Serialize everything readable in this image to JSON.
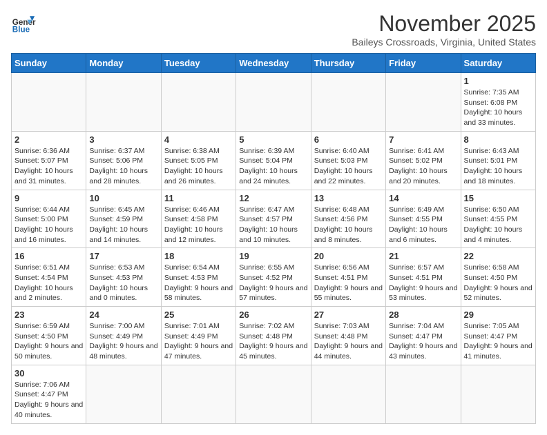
{
  "logo": {
    "text_general": "General",
    "text_blue": "Blue"
  },
  "title": "November 2025",
  "subtitle": "Baileys Crossroads, Virginia, United States",
  "days_of_week": [
    "Sunday",
    "Monday",
    "Tuesday",
    "Wednesday",
    "Thursday",
    "Friday",
    "Saturday"
  ],
  "weeks": [
    [
      {
        "day": "",
        "info": ""
      },
      {
        "day": "",
        "info": ""
      },
      {
        "day": "",
        "info": ""
      },
      {
        "day": "",
        "info": ""
      },
      {
        "day": "",
        "info": ""
      },
      {
        "day": "",
        "info": ""
      },
      {
        "day": "1",
        "info": "Sunrise: 7:35 AM\nSunset: 6:08 PM\nDaylight: 10 hours and 33 minutes."
      }
    ],
    [
      {
        "day": "2",
        "info": "Sunrise: 6:36 AM\nSunset: 5:07 PM\nDaylight: 10 hours and 31 minutes."
      },
      {
        "day": "3",
        "info": "Sunrise: 6:37 AM\nSunset: 5:06 PM\nDaylight: 10 hours and 28 minutes."
      },
      {
        "day": "4",
        "info": "Sunrise: 6:38 AM\nSunset: 5:05 PM\nDaylight: 10 hours and 26 minutes."
      },
      {
        "day": "5",
        "info": "Sunrise: 6:39 AM\nSunset: 5:04 PM\nDaylight: 10 hours and 24 minutes."
      },
      {
        "day": "6",
        "info": "Sunrise: 6:40 AM\nSunset: 5:03 PM\nDaylight: 10 hours and 22 minutes."
      },
      {
        "day": "7",
        "info": "Sunrise: 6:41 AM\nSunset: 5:02 PM\nDaylight: 10 hours and 20 minutes."
      },
      {
        "day": "8",
        "info": "Sunrise: 6:43 AM\nSunset: 5:01 PM\nDaylight: 10 hours and 18 minutes."
      }
    ],
    [
      {
        "day": "9",
        "info": "Sunrise: 6:44 AM\nSunset: 5:00 PM\nDaylight: 10 hours and 16 minutes."
      },
      {
        "day": "10",
        "info": "Sunrise: 6:45 AM\nSunset: 4:59 PM\nDaylight: 10 hours and 14 minutes."
      },
      {
        "day": "11",
        "info": "Sunrise: 6:46 AM\nSunset: 4:58 PM\nDaylight: 10 hours and 12 minutes."
      },
      {
        "day": "12",
        "info": "Sunrise: 6:47 AM\nSunset: 4:57 PM\nDaylight: 10 hours and 10 minutes."
      },
      {
        "day": "13",
        "info": "Sunrise: 6:48 AM\nSunset: 4:56 PM\nDaylight: 10 hours and 8 minutes."
      },
      {
        "day": "14",
        "info": "Sunrise: 6:49 AM\nSunset: 4:55 PM\nDaylight: 10 hours and 6 minutes."
      },
      {
        "day": "15",
        "info": "Sunrise: 6:50 AM\nSunset: 4:55 PM\nDaylight: 10 hours and 4 minutes."
      }
    ],
    [
      {
        "day": "16",
        "info": "Sunrise: 6:51 AM\nSunset: 4:54 PM\nDaylight: 10 hours and 2 minutes."
      },
      {
        "day": "17",
        "info": "Sunrise: 6:53 AM\nSunset: 4:53 PM\nDaylight: 10 hours and 0 minutes."
      },
      {
        "day": "18",
        "info": "Sunrise: 6:54 AM\nSunset: 4:53 PM\nDaylight: 9 hours and 58 minutes."
      },
      {
        "day": "19",
        "info": "Sunrise: 6:55 AM\nSunset: 4:52 PM\nDaylight: 9 hours and 57 minutes."
      },
      {
        "day": "20",
        "info": "Sunrise: 6:56 AM\nSunset: 4:51 PM\nDaylight: 9 hours and 55 minutes."
      },
      {
        "day": "21",
        "info": "Sunrise: 6:57 AM\nSunset: 4:51 PM\nDaylight: 9 hours and 53 minutes."
      },
      {
        "day": "22",
        "info": "Sunrise: 6:58 AM\nSunset: 4:50 PM\nDaylight: 9 hours and 52 minutes."
      }
    ],
    [
      {
        "day": "23",
        "info": "Sunrise: 6:59 AM\nSunset: 4:50 PM\nDaylight: 9 hours and 50 minutes."
      },
      {
        "day": "24",
        "info": "Sunrise: 7:00 AM\nSunset: 4:49 PM\nDaylight: 9 hours and 48 minutes."
      },
      {
        "day": "25",
        "info": "Sunrise: 7:01 AM\nSunset: 4:49 PM\nDaylight: 9 hours and 47 minutes."
      },
      {
        "day": "26",
        "info": "Sunrise: 7:02 AM\nSunset: 4:48 PM\nDaylight: 9 hours and 45 minutes."
      },
      {
        "day": "27",
        "info": "Sunrise: 7:03 AM\nSunset: 4:48 PM\nDaylight: 9 hours and 44 minutes."
      },
      {
        "day": "28",
        "info": "Sunrise: 7:04 AM\nSunset: 4:47 PM\nDaylight: 9 hours and 43 minutes."
      },
      {
        "day": "29",
        "info": "Sunrise: 7:05 AM\nSunset: 4:47 PM\nDaylight: 9 hours and 41 minutes."
      }
    ],
    [
      {
        "day": "30",
        "info": "Sunrise: 7:06 AM\nSunset: 4:47 PM\nDaylight: 9 hours and 40 minutes."
      },
      {
        "day": "",
        "info": ""
      },
      {
        "day": "",
        "info": ""
      },
      {
        "day": "",
        "info": ""
      },
      {
        "day": "",
        "info": ""
      },
      {
        "day": "",
        "info": ""
      },
      {
        "day": "",
        "info": ""
      }
    ]
  ]
}
